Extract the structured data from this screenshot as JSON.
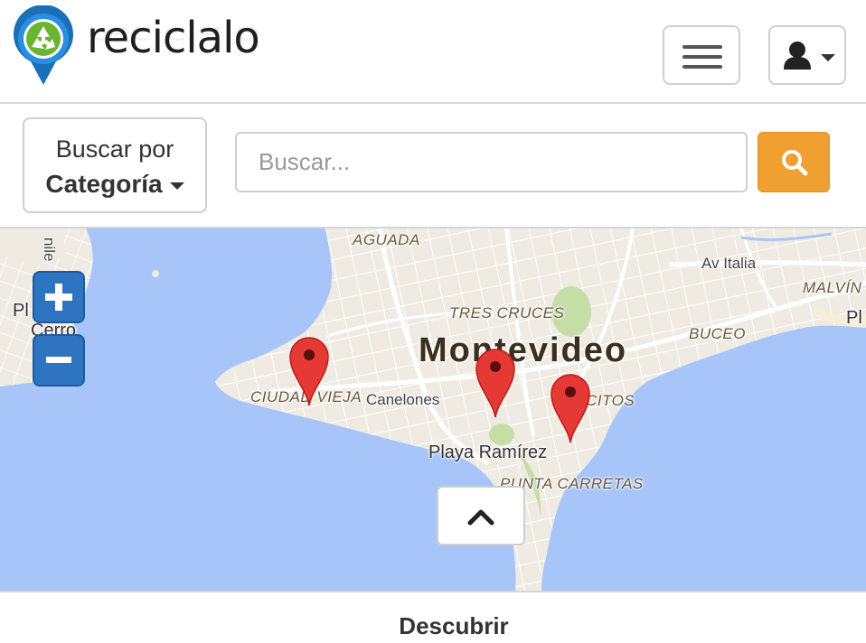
{
  "brand": {
    "name": "reciclalo",
    "logo_icon": "recycle-pin-icon"
  },
  "header": {
    "menu_icon": "hamburger-icon",
    "user_icon": "user-icon",
    "user_caret_icon": "caret-down-icon"
  },
  "search": {
    "category_line1": "Buscar por",
    "category_line2": "Categoría",
    "placeholder": "Buscar...",
    "button_icon": "search-icon",
    "button_color": "#f0a030"
  },
  "map": {
    "city": "Montevideo",
    "labels": {
      "aguada": "AGUADA",
      "av_italia": "Av Italia",
      "malvin": "MALVÍN",
      "pl": "Pl",
      "tres_cruces": "TRES CRUCES",
      "buceo": "BUCEO",
      "ciudad_vieja": "CIUDAD VIEJA",
      "canelones": "Canelones",
      "pocitos": "CITOS",
      "playa_ramirez": "Playa Ramírez",
      "punta_carretas": "PUNTA CARRETAS",
      "cerro_top": "Pl     el",
      "cerro_bottom": "Cerro",
      "nile": "nile"
    },
    "zoom_in_icon": "plus-icon",
    "zoom_out_icon": "minus-icon",
    "marker_icon": "map-marker-icon",
    "marker_color": "#e53935",
    "water_color": "#a7c5f9",
    "land_color": "#efebe2",
    "park_color": "#c5dea6",
    "collapse_icon": "chevron-up-icon"
  },
  "footer": {
    "label": "Descubrir"
  }
}
